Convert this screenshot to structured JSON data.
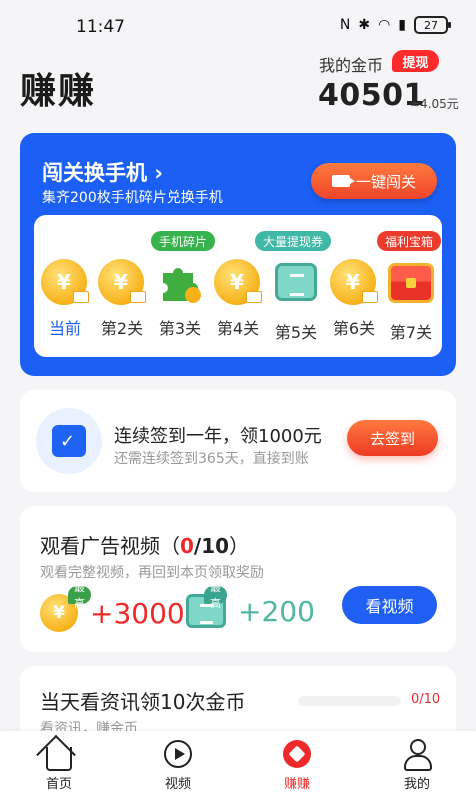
{
  "status_bar": {
    "time": "11:47",
    "battery": "27"
  },
  "header": {
    "title": "赚赚",
    "coin_label": "我的金币",
    "withdraw_label": "提现",
    "coin_value": "40501",
    "coin_cash": "≈4.05元"
  },
  "challenge": {
    "title": "闯关换手机",
    "arrow": "›",
    "subtitle": "集齐200枚手机碎片兑换手机",
    "button_label": "一键闯关",
    "tags": {
      "phone_fragment": "手机碎片",
      "voucher": "大量提现券",
      "treasure": "福利宝箱"
    },
    "levels": [
      {
        "label": "当前",
        "icon": "coin-icon",
        "current": true
      },
      {
        "label": "第2关",
        "icon": "coin-icon"
      },
      {
        "label": "第3关",
        "icon": "puzzle-piece-icon"
      },
      {
        "label": "第4关",
        "icon": "coin-icon"
      },
      {
        "label": "第5关",
        "icon": "voucher-icon"
      },
      {
        "label": "第6关",
        "icon": "coin-icon"
      },
      {
        "label": "第7关",
        "icon": "treasure-chest-icon"
      }
    ]
  },
  "signin": {
    "title": "连续签到一年，领1000元",
    "subtitle": "还需连续签到365天，直接到账",
    "button_label": "去签到"
  },
  "video": {
    "title_prefix": "观看广告视频（",
    "progress_num": "0",
    "progress_den": "/10",
    "title_suffix": "）",
    "subtitle": "观看完整视频，再回到本页领取奖励",
    "coin_badge": "最高",
    "coin_amount": "+3000",
    "voucher_badge": "最高",
    "voucher_amount": "+200",
    "button_label": "看视频"
  },
  "news": {
    "title": "当天看资讯领10次金币",
    "subtitle": "看资讯，赚金币",
    "progress_text": "0/10",
    "progress_fraction": 0
  },
  "tabs": [
    {
      "label": "首页",
      "icon": "home-icon"
    },
    {
      "label": "视频",
      "icon": "play-icon"
    },
    {
      "label": "赚赚",
      "icon": "earn-icon",
      "active": true
    },
    {
      "label": "我的",
      "icon": "person-icon"
    }
  ],
  "colors": {
    "primary_blue": "#1b5ff5",
    "accent_red": "#ee2a2a",
    "accent_orange": "#ff7a3e"
  }
}
